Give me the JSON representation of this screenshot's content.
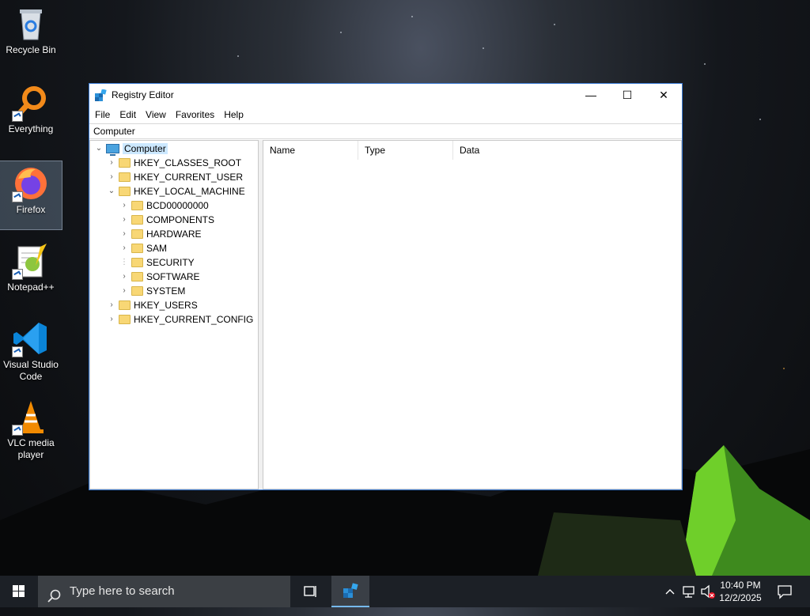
{
  "desktop": {
    "icons": [
      {
        "label": "Recycle Bin"
      },
      {
        "label": "Everything"
      },
      {
        "label": "Firefox"
      },
      {
        "label": "Notepad++"
      },
      {
        "label": "Visual Studio Code"
      },
      {
        "label": "VLC media player"
      }
    ]
  },
  "window": {
    "title": "Registry Editor",
    "controls": {
      "minimize": "—",
      "maximize": "☐",
      "close": "✕"
    },
    "menu": [
      "File",
      "Edit",
      "View",
      "Favorites",
      "Help"
    ],
    "address": "Computer",
    "tree": {
      "root": "Computer",
      "hives": [
        {
          "label": "HKEY_CLASSES_ROOT"
        },
        {
          "label": "HKEY_CURRENT_USER"
        },
        {
          "label": "HKEY_LOCAL_MACHINE"
        },
        {
          "label": "BCD00000000"
        },
        {
          "label": "COMPONENTS"
        },
        {
          "label": "HARDWARE"
        },
        {
          "label": "SAM"
        },
        {
          "label": "SECURITY"
        },
        {
          "label": "SOFTWARE"
        },
        {
          "label": "SYSTEM"
        },
        {
          "label": "HKEY_USERS"
        },
        {
          "label": "HKEY_CURRENT_CONFIG"
        }
      ]
    },
    "list": {
      "columns": [
        "Name",
        "Type",
        "Data"
      ]
    }
  },
  "taskbar": {
    "search_placeholder": "Type here to search",
    "time": "10:40 PM",
    "date": "12/2/2025"
  },
  "colors": {
    "accent": "#0078d7",
    "selection": "#cce8ff",
    "folder": "#f8d775",
    "taskbar": "#1c2026"
  }
}
